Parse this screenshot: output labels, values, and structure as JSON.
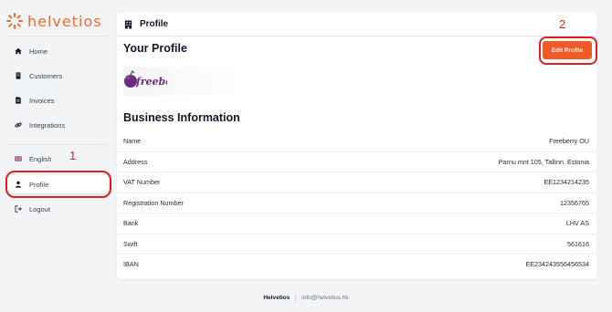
{
  "app": {
    "name": "helvetios",
    "accent": "#f15a24",
    "annotation_color": "#e11d24"
  },
  "sidebar": {
    "items": [
      {
        "label": "Home",
        "icon": "home-icon"
      },
      {
        "label": "Customers",
        "icon": "building-icon"
      },
      {
        "label": "Invoices",
        "icon": "document-icon"
      },
      {
        "label": "Integrations",
        "icon": "link-icon"
      }
    ],
    "language": {
      "label": "English",
      "icon": "uk-flag-icon"
    },
    "profile": {
      "label": "Profile",
      "icon": "user-icon",
      "active": true
    },
    "logout": {
      "label": "Logout",
      "icon": "logout-icon"
    }
  },
  "annotations": {
    "step1": "1",
    "step2": "2"
  },
  "main": {
    "header_title": "Profile",
    "your_profile_title": "Your Profile",
    "edit_button": "Edit Profile",
    "company_logo_text": "freeberry",
    "business_title": "Business Information",
    "rows": [
      {
        "key": "Name",
        "value": "Freeberry OU"
      },
      {
        "key": "Address",
        "value": "Parnu mnt 105, Tallinn, Estonia"
      },
      {
        "key": "VAT Number",
        "value": "EE1234214235"
      },
      {
        "key": "Registration Number",
        "value": "12356765"
      },
      {
        "key": "Bank",
        "value": "LHV AS"
      },
      {
        "key": "Swift",
        "value": "561616"
      },
      {
        "key": "IBAN",
        "value": "EE234243556456534"
      }
    ]
  },
  "footer": {
    "brand": "Helvetios",
    "email": "info@helvetios.hk"
  }
}
